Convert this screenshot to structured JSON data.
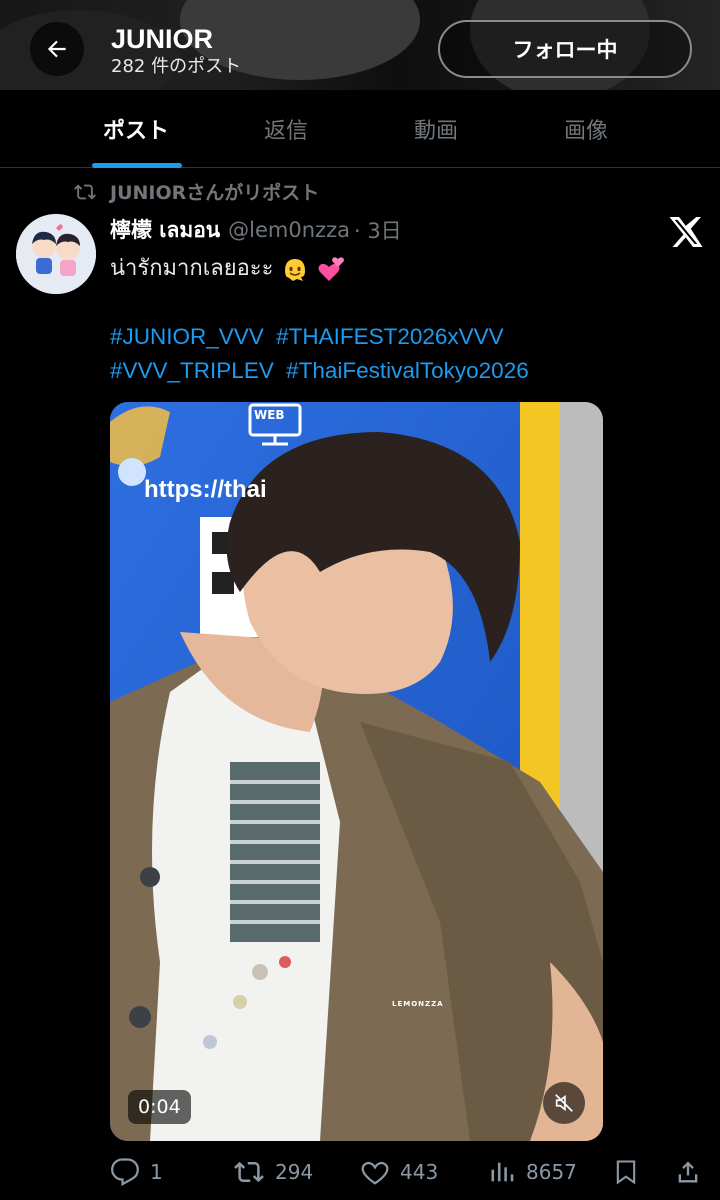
{
  "header": {
    "title": "JUNIOR",
    "post_count": "282 件のポスト",
    "follow_label": "フォロー中"
  },
  "tabs": [
    {
      "label": "ポスト",
      "active": true
    },
    {
      "label": "返信",
      "active": false
    },
    {
      "label": "動画",
      "active": false
    },
    {
      "label": "画像",
      "active": false
    }
  ],
  "repost": {
    "label": "JUNIORさんがリポスト"
  },
  "post": {
    "display_name": "檸檬 เลมอน",
    "handle": "@lem0nzza",
    "time": "· 3日",
    "text": "น่ารักมากเลยอะะ",
    "hashtags_line1": [
      "#JUNIOR_VVV",
      "#THAIFEST2026xVVV"
    ],
    "hashtags_line2": [
      "#VVV_TRIPLEV",
      "#ThaiFestivalTokyo2026"
    ],
    "video": {
      "duration": "0:04",
      "sign_text": "https://thai",
      "web_label": "WEB",
      "watermark": "LEMONZZA"
    }
  },
  "actions": {
    "replies": "1",
    "reposts": "294",
    "likes": "443",
    "views": "8657"
  },
  "colors": {
    "accent": "#1d9bf0",
    "muted": "#71767b",
    "background": "#000000"
  }
}
